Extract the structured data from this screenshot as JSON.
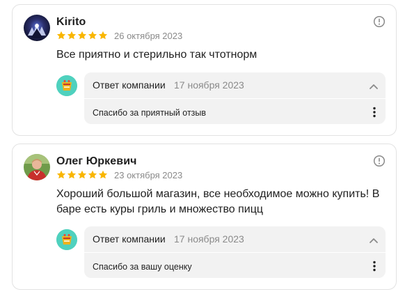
{
  "reviews": [
    {
      "author": "Kirito",
      "rating": 5,
      "rating_max": 5,
      "date": "26 октября 2023",
      "text": "Все приятно и стерильно так чтотнорм",
      "reply": {
        "title": "Ответ компании",
        "date": "17 ноября 2023",
        "text": "Спасибо за приятный отзыв"
      }
    },
    {
      "author": "Олег Юркевич",
      "rating": 5,
      "rating_max": 5,
      "date": "23 октября 2023",
      "text": "Хороший большой магазин, все необходимое можно купить! В баре есть куры гриль и множество пицц",
      "reply": {
        "title": "Ответ компании",
        "date": "17 ноября 2023",
        "text": "Спасибо за вашу оценку"
      }
    }
  ],
  "colors": {
    "star": "#f9b600",
    "muted_text": "#8a8a8a",
    "reply_bg": "#f2f2f2",
    "company_logo_bg": "#4fd1be",
    "card_border": "#e2e2e2"
  },
  "icons": {
    "info": "info-circle-icon",
    "collapse": "chevron-up-icon",
    "more": "vertical-ellipsis-icon",
    "star": "star-icon"
  }
}
